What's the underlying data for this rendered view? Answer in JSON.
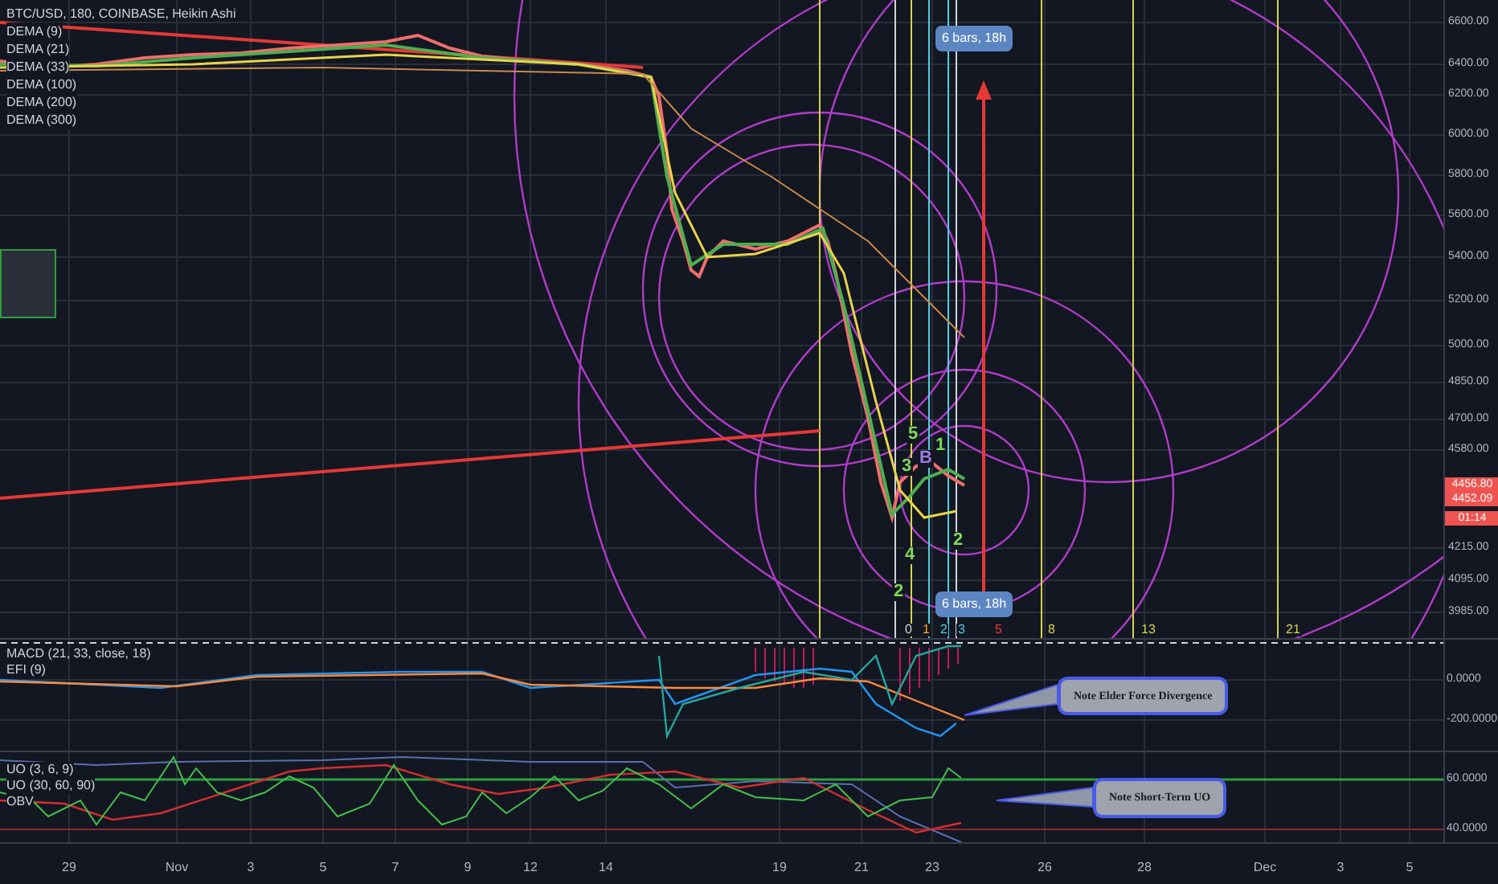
{
  "legend": {
    "title": "BTC/USD, 180, COINBASE, Heikin Ashi",
    "indicators": [
      "DEMA (9)",
      "DEMA (21)",
      "DEMA (33)",
      "DEMA (100)",
      "DEMA (200)",
      "DEMA (300)"
    ]
  },
  "price_axis": {
    "ticks": [
      "6600.00",
      "6400.00",
      "6200.00",
      "6000.00",
      "5800.00",
      "5600.00",
      "5400.00",
      "5200.00",
      "5000.00",
      "4850.00",
      "4700.00",
      "4580.00",
      "4215.00",
      "4095.00",
      "3985.00"
    ],
    "tags": [
      "4456.80",
      "4452.09",
      "01:14"
    ]
  },
  "annotations": {
    "measure_labels": [
      "6 bars, 18h",
      "6 bars, 18h"
    ],
    "wave_labels": [
      {
        "text": "5",
        "color": "#7ed957"
      },
      {
        "text": "3",
        "color": "#7ed957"
      },
      {
        "text": "B",
        "color": "#9b7be0"
      },
      {
        "text": "1",
        "color": "#7ed957"
      },
      {
        "text": "4",
        "color": "#7ed957"
      },
      {
        "text": "2",
        "color": "#7ed957"
      },
      {
        "text": "2",
        "color": "#7ed957"
      }
    ],
    "fib_time_labels": [
      {
        "text": "0",
        "color": "#d1d4dc"
      },
      {
        "text": "1",
        "color": "#f5a623"
      },
      {
        "text": "2",
        "color": "#4dd0e1"
      },
      {
        "text": "3",
        "color": "#4dd0e1"
      },
      {
        "text": "5",
        "color": "#e53935"
      },
      {
        "text": "8",
        "color": "#d4d44a"
      },
      {
        "text": "13",
        "color": "#d4d44a"
      },
      {
        "text": "21",
        "color": "#d4d44a"
      }
    ]
  },
  "macd_pane": {
    "legend": [
      "MACD (21, 33, close, 18)",
      "EFI (9)"
    ],
    "axis_ticks": [
      "0.0000",
      "-200.0000"
    ],
    "note": "Note Elder Force Divergence"
  },
  "uo_pane": {
    "legend": [
      "UO (3, 6, 9)",
      "UO (30, 60, 90)",
      "OBV"
    ],
    "axis_ticks": [
      "60.0000",
      "40.0000"
    ],
    "note": "Note Short-Term UO"
  },
  "time_axis": {
    "labels": [
      "29",
      "Nov",
      "3",
      "5",
      "7",
      "9",
      "12",
      "14",
      "19",
      "21",
      "23",
      "26",
      "28",
      "Dec",
      "3",
      "5"
    ]
  }
}
